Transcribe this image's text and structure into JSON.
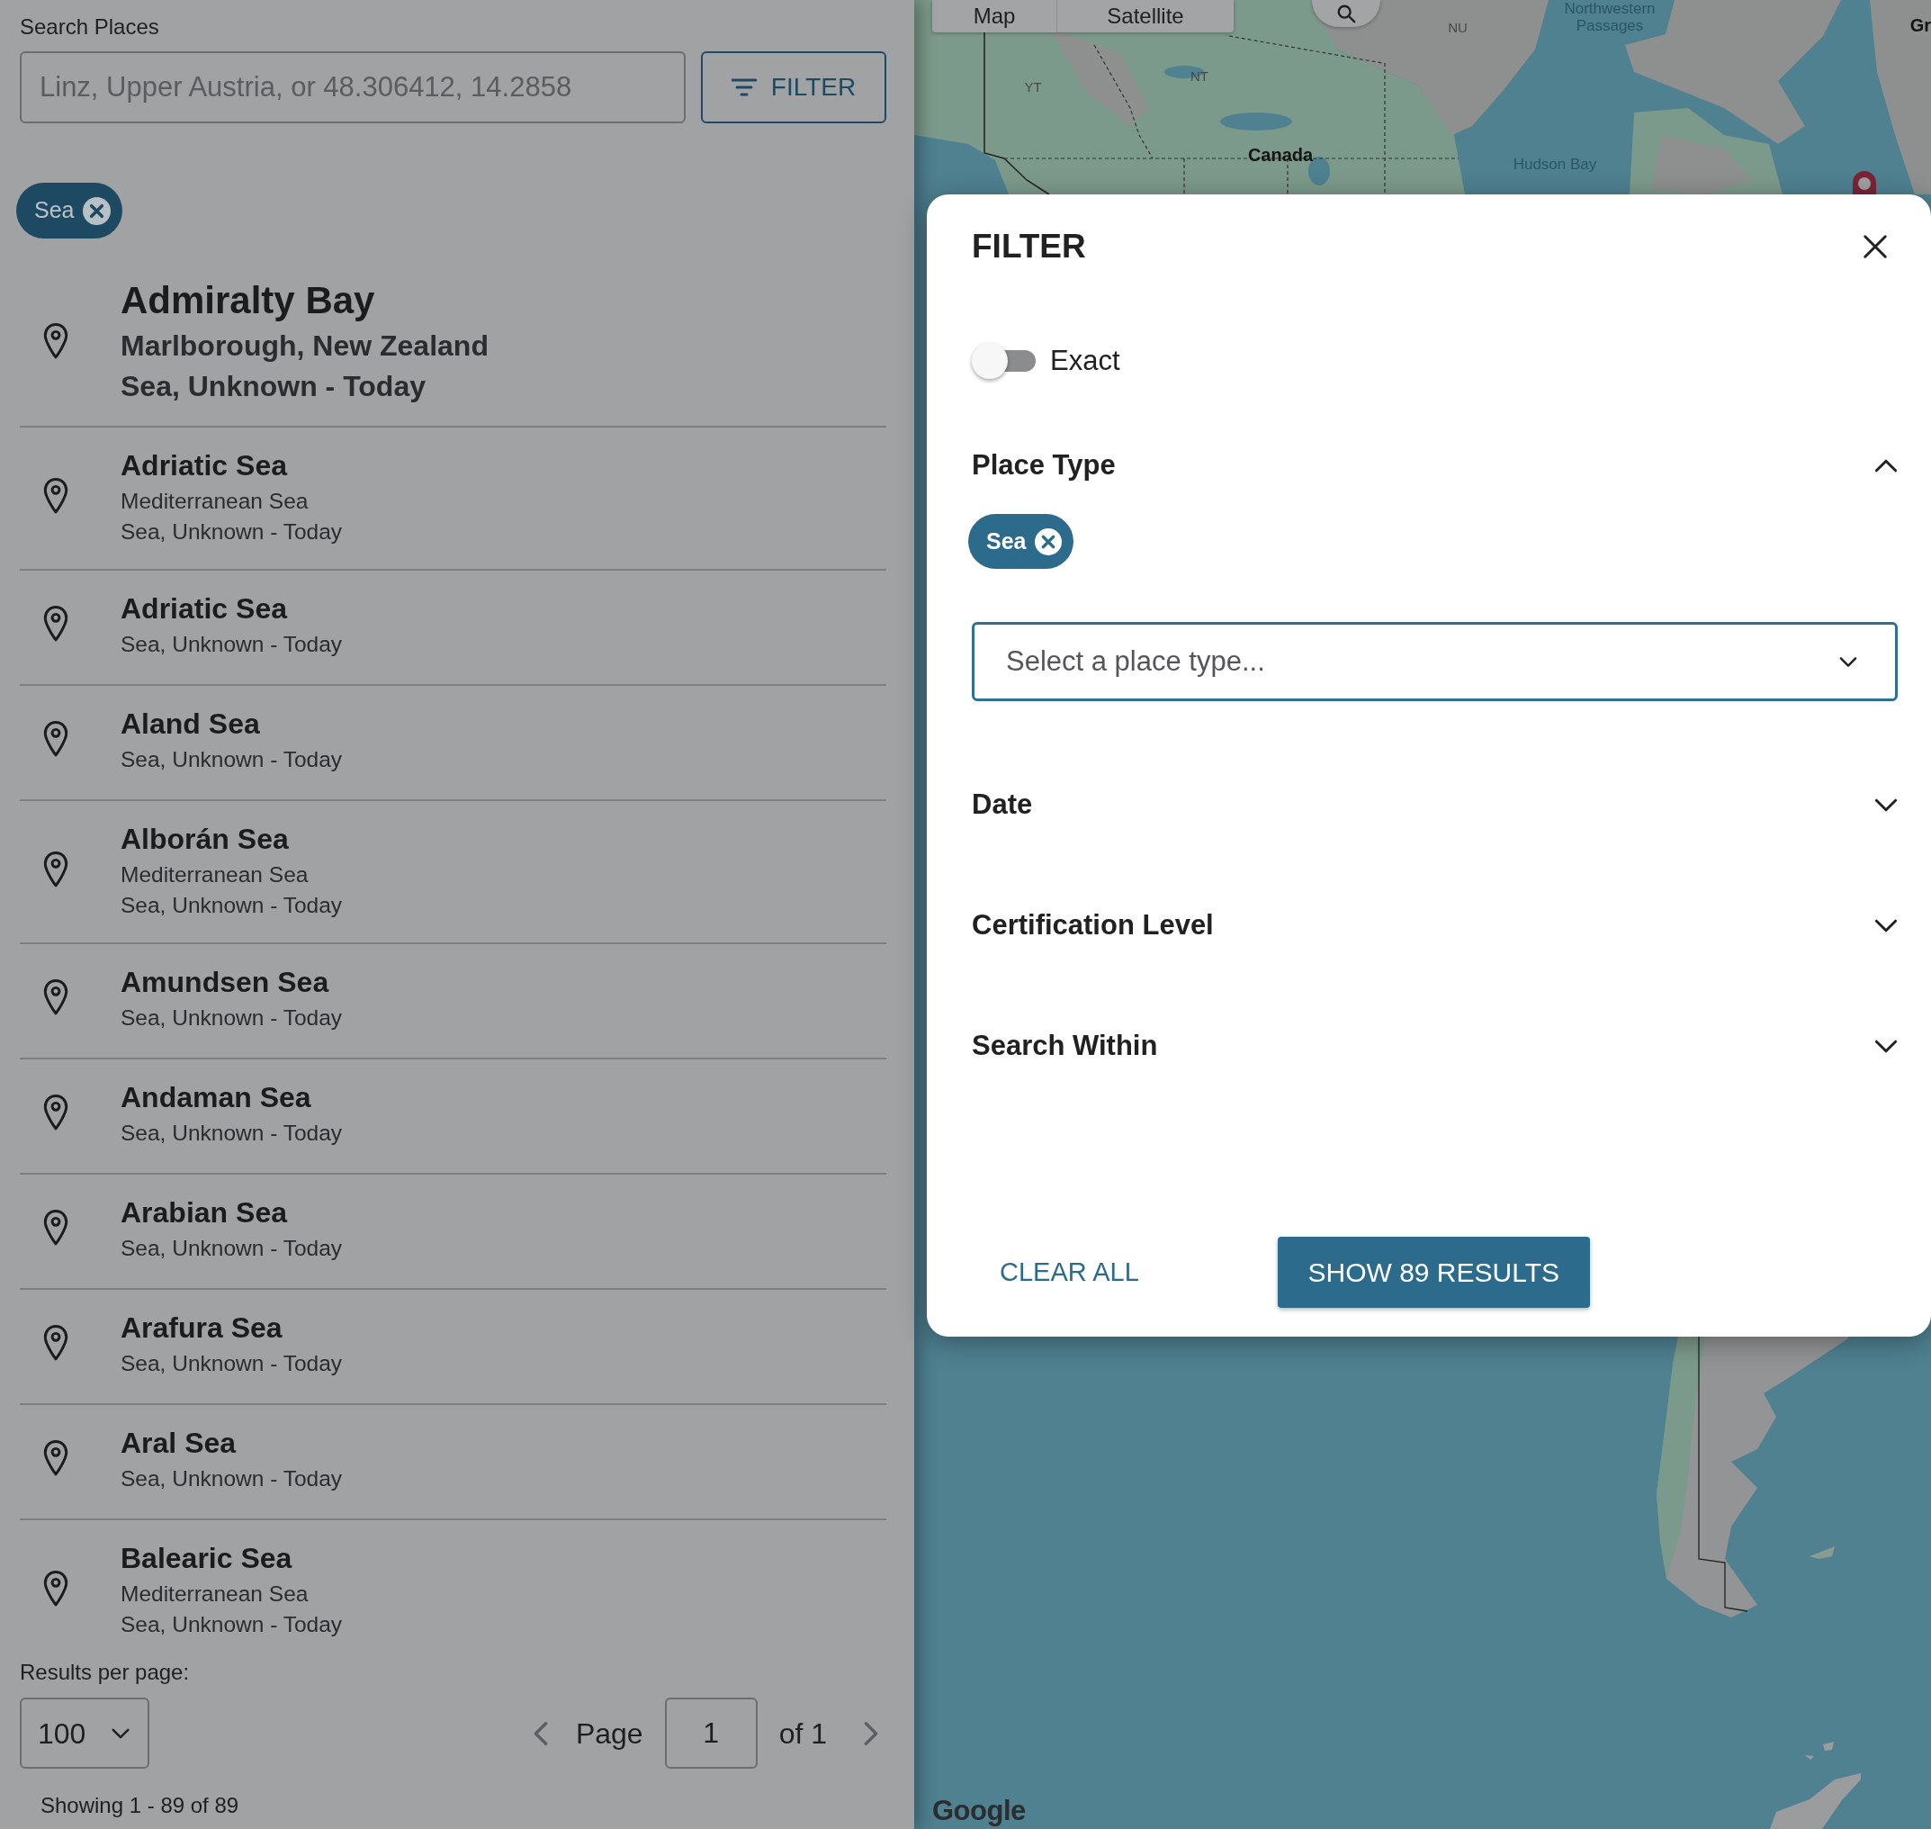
{
  "search": {
    "label": "Search Places",
    "placeholder": "Linz, Upper Austria, or 48.306412, 14.2858",
    "button": "FILTER"
  },
  "active_filters": [
    {
      "label": "Sea"
    }
  ],
  "results": [
    {
      "name": "Admiralty Bay",
      "region": "Marlborough, New Zealand",
      "details": "Sea, Unknown - Today",
      "selected": true
    },
    {
      "name": "Adriatic Sea",
      "region": "Mediterranean Sea",
      "details": "Sea, Unknown - Today",
      "selected": false
    },
    {
      "name": "Adriatic Sea",
      "details": "Sea, Unknown - Today",
      "selected": false
    },
    {
      "name": "Aland Sea",
      "details": "Sea, Unknown - Today",
      "selected": false
    },
    {
      "name": "Alborán Sea",
      "region": "Mediterranean Sea",
      "details": "Sea, Unknown - Today",
      "selected": false
    },
    {
      "name": "Amundsen Sea",
      "details": "Sea, Unknown - Today",
      "selected": false
    },
    {
      "name": "Andaman Sea",
      "details": "Sea, Unknown - Today",
      "selected": false
    },
    {
      "name": "Arabian Sea",
      "details": "Sea, Unknown - Today",
      "selected": false
    },
    {
      "name": "Arafura Sea",
      "details": "Sea, Unknown - Today",
      "selected": false
    },
    {
      "name": "Aral Sea",
      "details": "Sea, Unknown - Today",
      "selected": false
    },
    {
      "name": "Balearic Sea",
      "region": "Mediterranean Sea",
      "details": "Sea, Unknown - Today",
      "selected": false
    }
  ],
  "pagination": {
    "per_page_label": "Results per page:",
    "per_page": "100",
    "page_label": "Page",
    "page": "1",
    "page_count": "of 1",
    "summary": "Showing 1 - 89 of 89"
  },
  "map": {
    "type_buttons": [
      {
        "label": "Map"
      },
      {
        "label": "Satellite"
      }
    ],
    "labels": [
      {
        "text": "NU",
        "kind": "territory"
      },
      {
        "text": "Northwestern Passages",
        "kind": "water"
      },
      {
        "text": "Gr",
        "kind": "country"
      },
      {
        "text": "YT",
        "kind": "territory"
      },
      {
        "text": "NT",
        "kind": "territory"
      },
      {
        "text": "Canada",
        "kind": "country"
      },
      {
        "text": "Hudson Bay",
        "kind": "water"
      }
    ],
    "attribution": "Google"
  },
  "filter_panel": {
    "title": "FILTER",
    "exact": {
      "label": "Exact",
      "on": false
    },
    "sections": [
      {
        "title": "Place Type",
        "expanded": true,
        "chips": [
          {
            "label": "Sea"
          }
        ],
        "placeholder": "Select a place type..."
      },
      {
        "title": "Date",
        "expanded": false
      },
      {
        "title": "Certification Level",
        "expanded": false
      },
      {
        "title": "Search Within",
        "expanded": false
      }
    ],
    "clear_button": "CLEAR ALL",
    "apply_button": "SHOW 89 RESULTS"
  }
}
